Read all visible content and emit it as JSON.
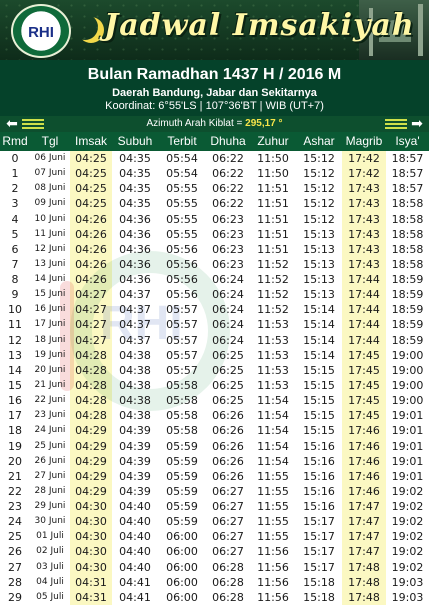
{
  "header": {
    "logo_text": "RHI",
    "app_title": "Jadwal Imsakiyah",
    "line1": "Bulan Ramadhan 1437 H / 2016 M",
    "line2": "Daerah Bandung, Jabar dan Sekitarnya",
    "line3": "Koordinat: 6°55'LS | 107°36'BT | WIB (UT+7)"
  },
  "nav": {
    "azimuth_label": "Azimuth Arah Kiblat = ",
    "azimuth_value": "295,17 °",
    "prev_icon": "left-arrow-icon",
    "next_icon": "right-arrow-icon"
  },
  "table": {
    "columns": [
      "Rmd",
      "Tgl",
      "Imsak",
      "Subuh",
      "Terbit",
      "Dhuha",
      "Zuhur",
      "Ashar",
      "Magrib",
      "Isya'"
    ],
    "rows": [
      [
        "0",
        "06 Juni",
        "04:25",
        "04:35",
        "05:54",
        "06:22",
        "11:50",
        "15:12",
        "17:42",
        "18:57"
      ],
      [
        "1",
        "07 Juni",
        "04:25",
        "04:35",
        "05:54",
        "06:22",
        "11:50",
        "15:12",
        "17:42",
        "18:57"
      ],
      [
        "2",
        "08 Juni",
        "04:25",
        "04:35",
        "05:55",
        "06:22",
        "11:51",
        "15:12",
        "17:43",
        "18:57"
      ],
      [
        "3",
        "09 Juni",
        "04:25",
        "04:35",
        "05:55",
        "06:22",
        "11:51",
        "15:12",
        "17:43",
        "18:58"
      ],
      [
        "4",
        "10 Juni",
        "04:26",
        "04:36",
        "05:55",
        "06:23",
        "11:51",
        "15:12",
        "17:43",
        "18:58"
      ],
      [
        "5",
        "11 Juni",
        "04:26",
        "04:36",
        "05:55",
        "06:23",
        "11:51",
        "15:13",
        "17:43",
        "18:58"
      ],
      [
        "6",
        "12 Juni",
        "04:26",
        "04:36",
        "05:56",
        "06:23",
        "11:51",
        "15:13",
        "17:43",
        "18:58"
      ],
      [
        "7",
        "13 Juni",
        "04:26",
        "04:36",
        "05:56",
        "06:23",
        "11:52",
        "15:13",
        "17:43",
        "18:58"
      ],
      [
        "8",
        "14 Juni",
        "04:26",
        "04:36",
        "05:56",
        "06:24",
        "11:52",
        "15:13",
        "17:44",
        "18:59"
      ],
      [
        "9",
        "15 Juni",
        "04:27",
        "04:37",
        "05:56",
        "06:24",
        "11:52",
        "15:13",
        "17:44",
        "18:59"
      ],
      [
        "10",
        "16 Juni",
        "04:27",
        "04:37",
        "05:57",
        "06:24",
        "11:52",
        "15:14",
        "17:44",
        "18:59"
      ],
      [
        "11",
        "17 Juni",
        "04:27",
        "04:37",
        "05:57",
        "06:24",
        "11:53",
        "15:14",
        "17:44",
        "18:59"
      ],
      [
        "12",
        "18 Juni",
        "04:27",
        "04:37",
        "05:57",
        "06:24",
        "11:53",
        "15:14",
        "17:44",
        "18:59"
      ],
      [
        "13",
        "19 Juni",
        "04:28",
        "04:38",
        "05:57",
        "06:25",
        "11:53",
        "15:14",
        "17:45",
        "19:00"
      ],
      [
        "14",
        "20 Juni",
        "04:28",
        "04:38",
        "05:57",
        "06:25",
        "11:53",
        "15:15",
        "17:45",
        "19:00"
      ],
      [
        "15",
        "21 Juni",
        "04:28",
        "04:38",
        "05:58",
        "06:25",
        "11:53",
        "15:15",
        "17:45",
        "19:00"
      ],
      [
        "16",
        "22 Juni",
        "04:28",
        "04:38",
        "05:58",
        "06:25",
        "11:54",
        "15:15",
        "17:45",
        "19:00"
      ],
      [
        "17",
        "23 Juni",
        "04:28",
        "04:38",
        "05:58",
        "06:26",
        "11:54",
        "15:15",
        "17:45",
        "19:01"
      ],
      [
        "18",
        "24 Juni",
        "04:29",
        "04:39",
        "05:58",
        "06:26",
        "11:54",
        "15:15",
        "17:46",
        "19:01"
      ],
      [
        "19",
        "25 Juni",
        "04:29",
        "04:39",
        "05:59",
        "06:26",
        "11:54",
        "15:16",
        "17:46",
        "19:01"
      ],
      [
        "20",
        "26 Juni",
        "04:29",
        "04:39",
        "05:59",
        "06:26",
        "11:54",
        "15:16",
        "17:46",
        "19:01"
      ],
      [
        "21",
        "27 Juni",
        "04:29",
        "04:39",
        "05:59",
        "06:26",
        "11:55",
        "15:16",
        "17:46",
        "19:01"
      ],
      [
        "22",
        "28 Juni",
        "04:29",
        "04:39",
        "05:59",
        "06:27",
        "11:55",
        "15:16",
        "17:46",
        "19:02"
      ],
      [
        "23",
        "29 Juni",
        "04:30",
        "04:40",
        "05:59",
        "06:27",
        "11:55",
        "15:16",
        "17:47",
        "19:02"
      ],
      [
        "24",
        "30 Juni",
        "04:30",
        "04:40",
        "05:59",
        "06:27",
        "11:55",
        "15:17",
        "17:47",
        "19:02"
      ],
      [
        "25",
        "01 Juli",
        "04:30",
        "04:40",
        "06:00",
        "06:27",
        "11:55",
        "15:17",
        "17:47",
        "19:02"
      ],
      [
        "26",
        "02 Juli",
        "04:30",
        "04:40",
        "06:00",
        "06:27",
        "11:56",
        "15:17",
        "17:47",
        "19:02"
      ],
      [
        "27",
        "03 Juli",
        "04:30",
        "04:40",
        "06:00",
        "06:28",
        "11:56",
        "15:17",
        "17:48",
        "19:02"
      ],
      [
        "28",
        "04 Juli",
        "04:31",
        "04:41",
        "06:00",
        "06:28",
        "11:56",
        "15:18",
        "17:48",
        "19:03"
      ],
      [
        "29",
        "05 Juli",
        "04:31",
        "04:41",
        "06:00",
        "06:28",
        "11:56",
        "15:18",
        "17:48",
        "19:03"
      ]
    ]
  },
  "colors": {
    "header_green": "#0a5a34",
    "title_yellow": "#fff7a6",
    "highlight_column": "#fbf8c2",
    "azimuth_value": "#f6e44a"
  }
}
